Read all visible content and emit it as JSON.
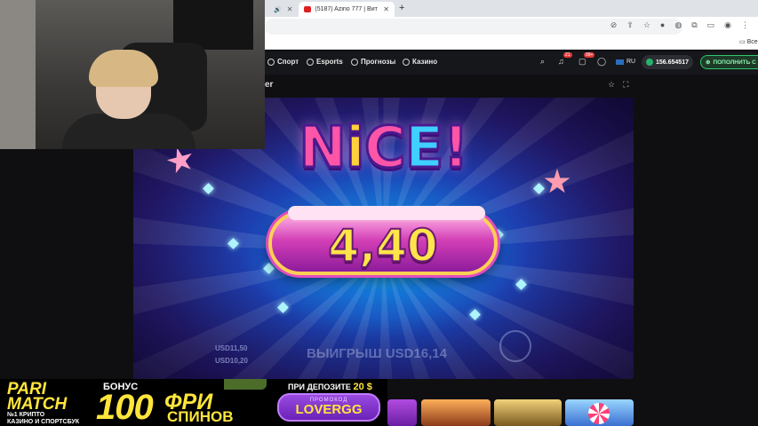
{
  "browser": {
    "tabs": [
      {
        "title": "(5187) Azino 777 | Вита АК-47",
        "active": true
      }
    ],
    "new_tab_symbol": "+",
    "bookmark_label": "Все"
  },
  "nav": {
    "items": [
      {
        "label": "Спорт",
        "icon": "sport-icon"
      },
      {
        "label": "Esports",
        "icon": "esports-icon"
      },
      {
        "label": "Прогнозы",
        "icon": "forecast-icon"
      },
      {
        "label": "Казино",
        "icon": "casino-icon"
      }
    ],
    "notification_badge": "21",
    "message_badge": "99+",
    "language": "RU",
    "balance": "156.654517",
    "deposit_label": "ПОПОЛНИТЬ С"
  },
  "game": {
    "title_fragment": "er",
    "headline": [
      "N",
      "i",
      "C",
      "E",
      "!"
    ],
    "win_amount": "4,40",
    "underlay_left_1": "USD11,50",
    "underlay_left_2": "USD10,20",
    "underlay_win": "ВЫИГРЫШ USD16,14"
  },
  "banner": {
    "brand": "PARI\nMATCH",
    "brand_sub": "№1 КРИПТО\nКАЗИНО И СПОРТСБУК",
    "bonus_label": "БОНУС",
    "bonus_amount": "100",
    "bonus_word1": "ФРИ",
    "bonus_word2": "СПИНОВ",
    "deposit_text": "ПРИ ДЕПОЗИТЕ",
    "deposit_amount": "20 $",
    "promo_label": "ПРОМОКОД",
    "promo_code": "LOVERGG"
  },
  "colors": {
    "accent_green": "#2fc86e",
    "brand_yellow": "#ffe53b",
    "nav_bg": "#16171b"
  }
}
